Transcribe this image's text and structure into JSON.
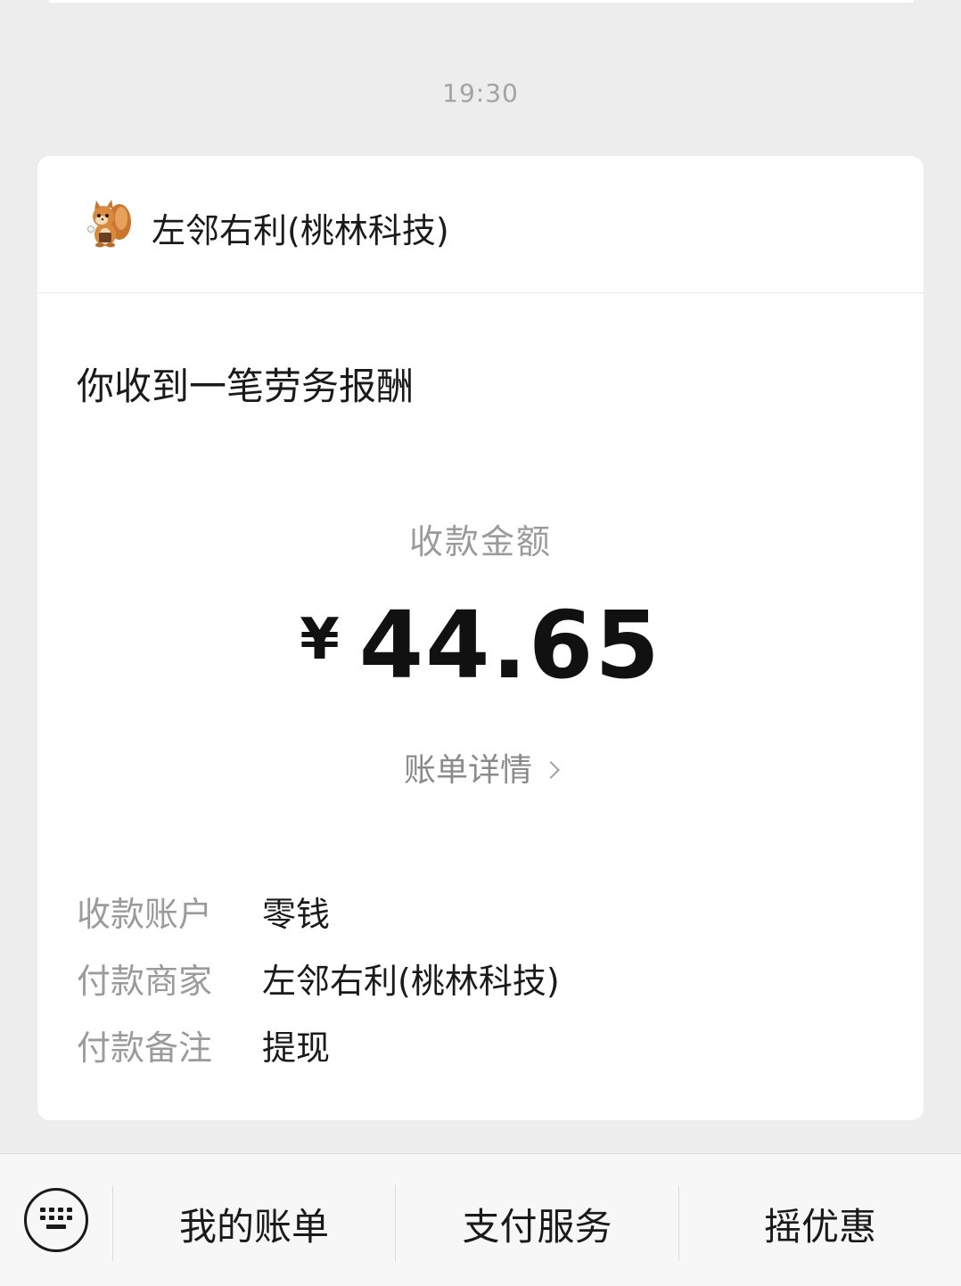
{
  "timestamp": "19:30",
  "merchant": {
    "name": "左邻右利(桃林科技)",
    "avatar_icon": "squirrel-mascot-icon"
  },
  "notice": {
    "title": "你收到一笔劳务报酬",
    "amount_label": "收款金额",
    "currency_symbol": "¥",
    "amount": "44.65",
    "bill_link_label": "账单详情"
  },
  "details": [
    {
      "label": "收款账户",
      "value": "零钱"
    },
    {
      "label": "付款商家",
      "value": "左邻右利(桃林科技)"
    },
    {
      "label": "付款备注",
      "value": "提现"
    }
  ],
  "bottom_menu": {
    "keyboard_icon": "keyboard-icon",
    "items": [
      {
        "label": "我的账单"
      },
      {
        "label": "支付服务"
      },
      {
        "label": "摇优惠"
      }
    ]
  }
}
